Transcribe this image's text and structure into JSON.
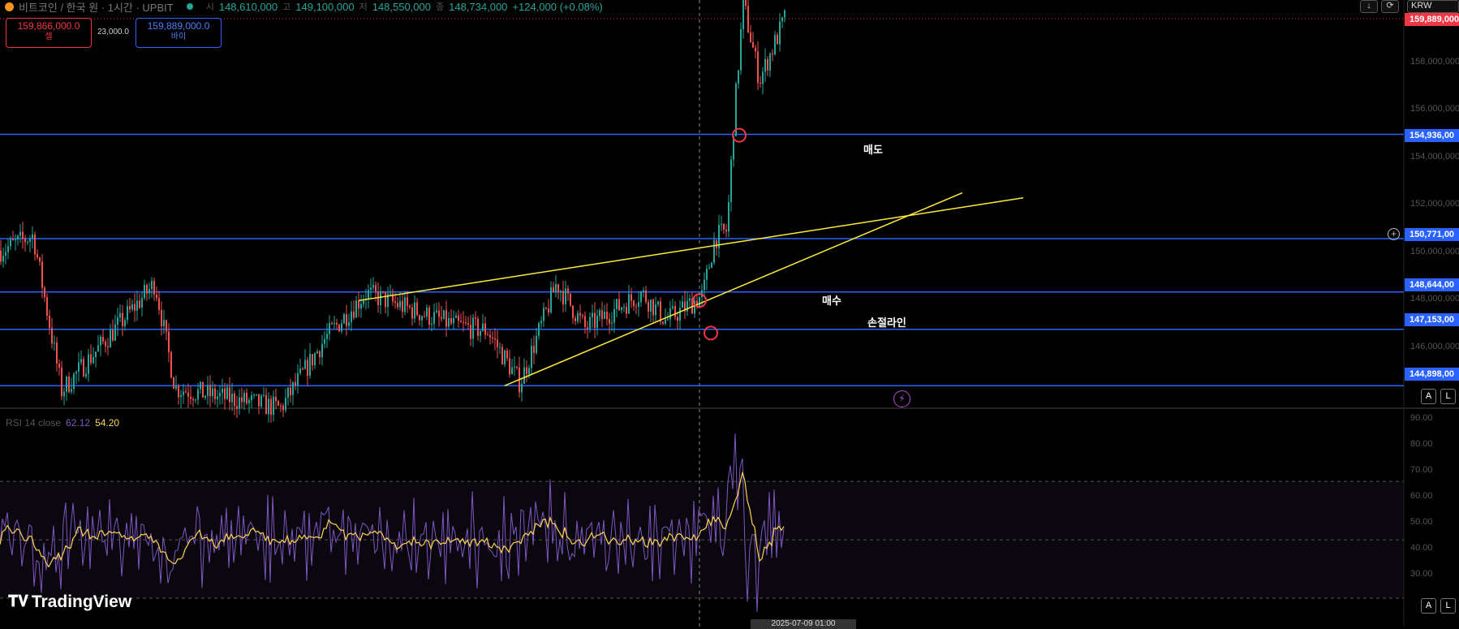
{
  "header": {
    "symbol": "비트코인 / 한국 원 · 1시간 · UPBIT",
    "o_label": "시",
    "o": "148,610,000",
    "h_label": "고",
    "h": "149,100,000",
    "l_label": "저",
    "l": "148,550,000",
    "c_label": "종",
    "c": "148,734,000",
    "change": "+124,000 (+0.08%)"
  },
  "order": {
    "sell_price": "159,866,000.0",
    "sell_label": "셀",
    "spread": "23,000.0",
    "buy_price": "159,889,000.0",
    "buy_label": "바이"
  },
  "toolbar": {
    "currency": "KRW",
    "auto": "A",
    "log": "L"
  },
  "price_axis": {
    "ticks": [
      "158,000,000",
      "156,000,000",
      "154,000,000",
      "152,000,000",
      "150,000,000",
      "148,000,000",
      "146,000,000"
    ],
    "current": "159,889,000"
  },
  "levels": [
    {
      "value": 154936000,
      "label": "154,936,00"
    },
    {
      "value": 150771000,
      "label": "150,771,00"
    },
    {
      "value": 148644000,
      "label": "148,644,00"
    },
    {
      "value": 147153000,
      "label": "147,153,00"
    },
    {
      "value": 144898000,
      "label": "144,898,00"
    }
  ],
  "annotations": {
    "sell": "매도",
    "buy": "매수",
    "stop": "손절라인"
  },
  "rsi": {
    "name": "RSI 14 close",
    "rsi_value": "62.12",
    "ma_value": "54.20",
    "ticks": [
      "90.00",
      "80.00",
      "70.00",
      "60.00",
      "50.00",
      "40.00",
      "30.00"
    ],
    "upper": 70,
    "lower": 30
  },
  "brand": "TradingView",
  "crosshair_date": "2025-07-09 01:00",
  "colors": {
    "up": "#26a69a",
    "down": "#ef5350",
    "level": "#2962ff",
    "trend": "#ffeb3b",
    "rsi": "#7e57c2",
    "rsima": "#ffd54f",
    "marker": "#f23645"
  },
  "chart_data": {
    "type": "candlestick",
    "price_ylim": [
      144000000,
      160300000
    ],
    "rsi_ylim": [
      20,
      92
    ],
    "candles_note": "",
    "key_points": [
      {
        "t": 0,
        "p": 150300000
      },
      {
        "t": 40,
        "p": 150900000
      },
      {
        "t": 75,
        "p": 144700000
      },
      {
        "t": 190,
        "p": 149000000
      },
      {
        "t": 215,
        "p": 144800000
      },
      {
        "t": 345,
        "p": 144000000
      },
      {
        "t": 400,
        "p": 146800000
      },
      {
        "t": 450,
        "p": 148600000
      },
      {
        "t": 560,
        "p": 147300000
      },
      {
        "t": 600,
        "p": 147100000
      },
      {
        "t": 640,
        "p": 145000000
      },
      {
        "t": 685,
        "p": 149000000
      },
      {
        "t": 720,
        "p": 147200000
      },
      {
        "t": 790,
        "p": 148600000
      },
      {
        "t": 820,
        "p": 147500000
      },
      {
        "t": 865,
        "p": 148500000
      },
      {
        "t": 880,
        "p": 150800000
      },
      {
        "t": 895,
        "p": 151100000
      },
      {
        "t": 903,
        "p": 155300000
      },
      {
        "t": 915,
        "p": 160200000
      },
      {
        "t": 935,
        "p": 157100000
      },
      {
        "t": 968,
        "p": 159700000
      }
    ],
    "trendlines": [
      {
        "t1": 442,
        "p1": 148300000,
        "t2": 1261,
        "p2": 152400000
      },
      {
        "t1": 622,
        "p1": 144900000,
        "t2": 1186,
        "p2": 152600000
      }
    ],
    "markers": [
      {
        "t": 911,
        "p": 154900000,
        "label": "sell"
      },
      {
        "t": 862,
        "p": 148300000,
        "label": "buy"
      },
      {
        "t": 876,
        "p": 147000000,
        "label": "stop"
      }
    ],
    "crosshair_t": 862
  }
}
